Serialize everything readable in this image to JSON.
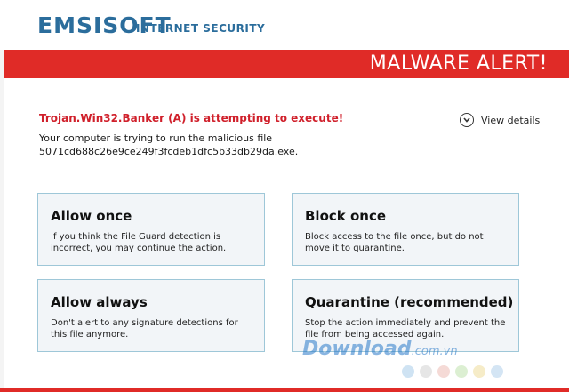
{
  "header": {
    "logo": "EMSISOFT",
    "logo_sub": "INTERNET SECURITY"
  },
  "alert_bar": {
    "text": "MALWARE ALERT!",
    "color": "#e02b27"
  },
  "threat": {
    "title": "Trojan.Win32.Banker (A) is attempting to execute!",
    "line1": "Your computer is trying to run the malicious file",
    "line2": "5071cd688c26e9ce249f3fcdeb1dfc5b33db29da.exe."
  },
  "view_details": {
    "label": "View details",
    "icon": "chevron-down-icon"
  },
  "actions": [
    {
      "title": "Allow once",
      "desc": "If you think the File Guard detection is incorrect, you may continue the action."
    },
    {
      "title": "Block once",
      "desc": "Block access to the file once, but do not move it to quarantine."
    },
    {
      "title": "Allow always",
      "desc": "Don't alert to any signature detections for this file anymore."
    },
    {
      "title": "Quarantine (recommended)",
      "desc": "Stop the action immediately and prevent the file from being accessed again."
    }
  ],
  "watermark": {
    "text": "Download",
    "suffix": ".com.vn"
  },
  "colors": {
    "brand": "#2b6d9c",
    "alert": "#e02b27",
    "threat_text": "#d0202b",
    "card_border": "#9ec7d8"
  }
}
